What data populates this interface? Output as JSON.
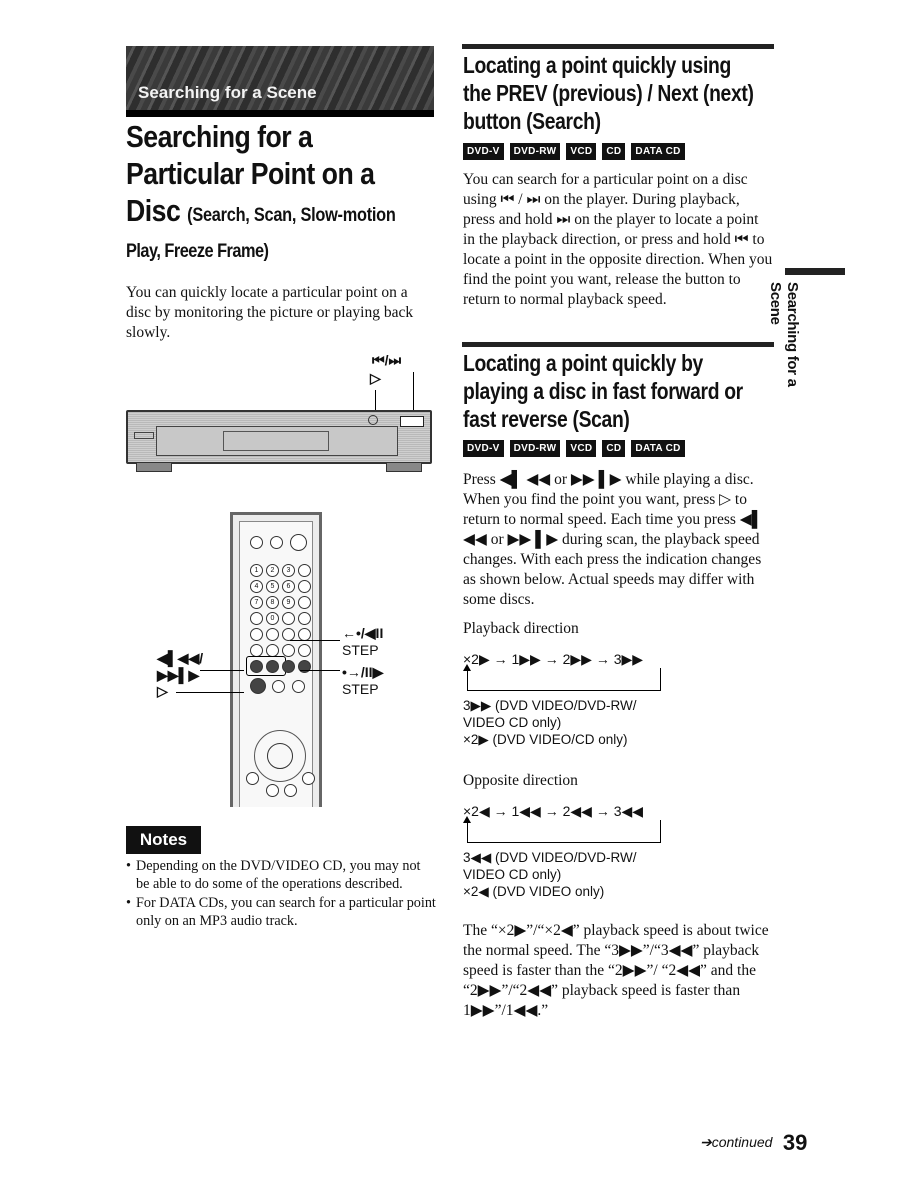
{
  "banner": {
    "text": "Searching for a Scene"
  },
  "main_title": {
    "line1": "Searching for a",
    "line2": "Particular Point on a",
    "line3_main": "Disc",
    "line3_sub": "(Search, Scan, Slow-motion",
    "line4": "Play, Freeze Frame)"
  },
  "intro": "You can quickly locate a particular point on a disc by monitoring the picture or playing back slowly.",
  "player_illustration": {
    "label_prev_next": "⏮/⏭",
    "label_play": "▷"
  },
  "remote_illustration": {
    "label_scan": "◀▌◀◀/\n▶▶▌▶",
    "label_play": "▷",
    "label_step_back": "←•/◀II",
    "label_step_back_sub": "STEP",
    "label_step_fwd": "•→/II▶",
    "label_step_fwd_sub": "STEP",
    "number_buttons": [
      "1",
      "2",
      "3",
      "4",
      "5",
      "6",
      "7",
      "8",
      "9",
      "0"
    ]
  },
  "notes": {
    "badge": "Notes",
    "items": [
      "Depending on the DVD/VIDEO CD, you may not be able to do some of the operations described.",
      "For DATA CDs, you can search for a particular point only on an MP3 audio track."
    ]
  },
  "section1": {
    "title_lines": [
      "Locating a point quickly using",
      "the PREV (previous) / Next (next)",
      "button (Search)"
    ],
    "badges": [
      "DVD-V",
      "DVD-RW",
      "VCD",
      "CD",
      "DATA CD"
    ],
    "body": "You can search for a particular point on a disc using ⏮ / ⏭ on the player. During playback, press and hold ⏭ on the player to locate a point in the playback direction, or press and hold ⏮ to locate a point in the opposite direction. When you find the point you want, release the button to return to normal playback speed."
  },
  "section2": {
    "title_lines": [
      "Locating a point quickly by",
      "playing a disc in fast forward or",
      "fast reverse (Scan)"
    ],
    "badges": [
      "DVD-V",
      "DVD-RW",
      "VCD",
      "CD",
      "DATA CD"
    ],
    "body": "Press ◀▌ ◀◀ or ▶▶ ▌▶ while playing a disc. When you find the point you want, press ▷ to return to normal speed. Each time you press ◀▌ ◀◀ or ▶▶ ▌▶ during scan, the playback speed changes. With each press the indication changes as shown below. Actual speeds may differ with some discs.",
    "playback": {
      "heading": "Playback direction",
      "sequence": "×2▶ → 1▶▶ → 2▶▶ → 3▶▶",
      "note_lines": [
        "3▶▶ (DVD VIDEO/DVD-RW/",
        "VIDEO CD only)",
        "×2▶ (DVD VIDEO/CD only)"
      ]
    },
    "opposite": {
      "heading": "Opposite direction",
      "sequence": "×2◀ → 1◀◀ → 2◀◀ → 3◀◀",
      "note_lines": [
        "3◀◀ (DVD VIDEO/DVD-RW/",
        "VIDEO CD only)",
        "×2◀ (DVD VIDEO only)"
      ]
    },
    "closing": "The “×2▶”/“×2◀” playback speed is about twice the normal speed. The “3▶▶”/“3◀◀” playback speed is faster than the “2▶▶”/ “2◀◀” and the “2▶▶”/“2◀◀” playback speed is faster than 1▶▶”/1◀◀.”"
  },
  "side_tab": {
    "text": "Searching for a Scene"
  },
  "footer": {
    "continued": "➔continued",
    "page_number": "39"
  }
}
